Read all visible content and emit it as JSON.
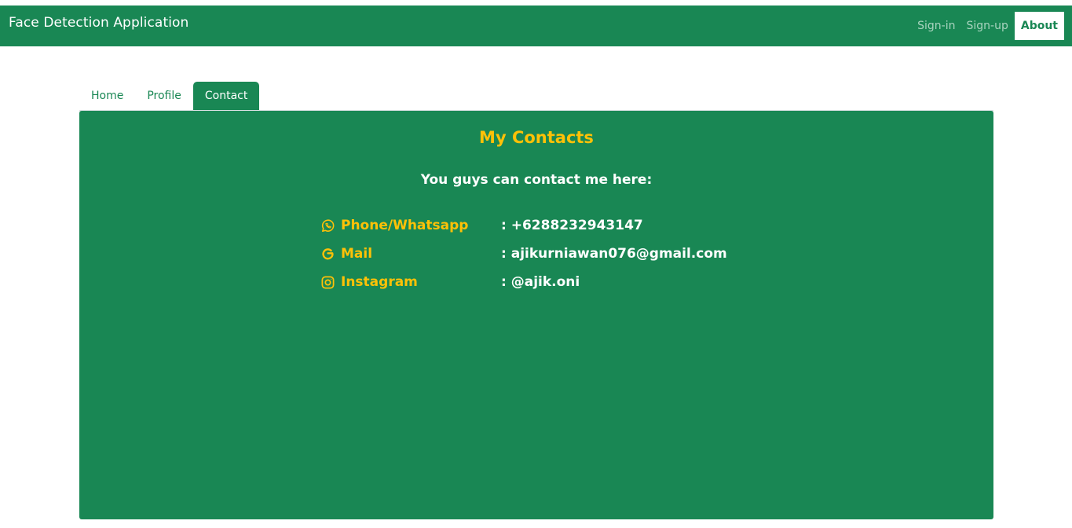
{
  "header": {
    "brand": "Face Detection Application",
    "nav": {
      "signin": "Sign-in",
      "signup": "Sign-up",
      "about": "About"
    }
  },
  "tabs": {
    "home": "Home",
    "profile": "Profile",
    "contact": "Contact"
  },
  "panel": {
    "title": "My Contacts",
    "subtitle": "You guys can contact me here:",
    "contacts": [
      {
        "icon": "whatsapp-icon",
        "label": "Phone/Whatsapp",
        "value": ": +6288232943147"
      },
      {
        "icon": "google-icon",
        "label": "Mail",
        "value": ": ajikurniawan076@gmail.com"
      },
      {
        "icon": "instagram-icon",
        "label": "Instagram",
        "value": ": @ajik.oni"
      }
    ]
  },
  "colors": {
    "brand_green": "#198754",
    "accent_yellow": "#ffc107",
    "text_white": "#ffffff"
  }
}
